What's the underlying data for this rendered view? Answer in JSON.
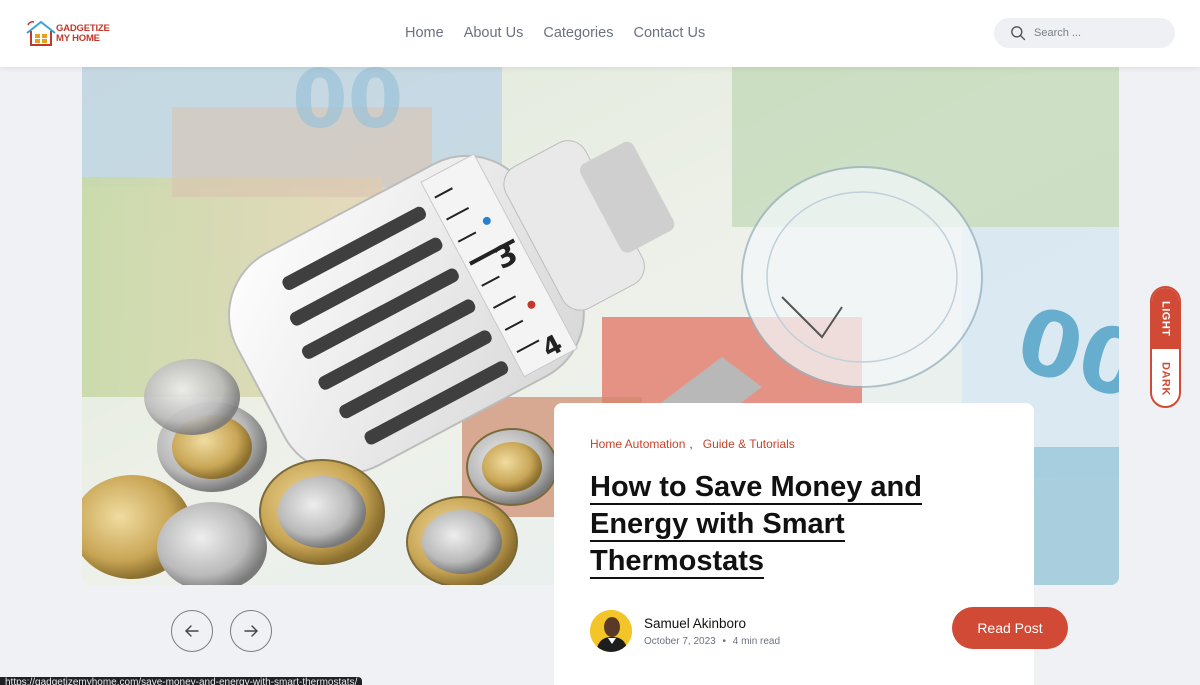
{
  "brand": {
    "line1": "GADGETIZE",
    "line2": "MY HOME"
  },
  "nav": [
    "Home",
    "About Us",
    "Categories",
    "Contact Us"
  ],
  "search": {
    "placeholder": "Search ..."
  },
  "post": {
    "categories": [
      "Home Automation",
      "Guide & Tutorials"
    ],
    "category_separator": ",",
    "title": "How to Save Money and Energy with Smart Thermostats",
    "author": "Samuel Akinboro",
    "date": "October 7, 2023",
    "read_time": "4 min read",
    "read_button": "Read Post"
  },
  "theme": {
    "light": "LIGHT",
    "dark": "DARK"
  },
  "status_url": "https://gadgetizemyhome.com/save-money-and-energy-with-smart-thermostats/",
  "colors": {
    "accent": "#d14a35",
    "brand": "#c0392b",
    "background": "#eff1f5"
  }
}
